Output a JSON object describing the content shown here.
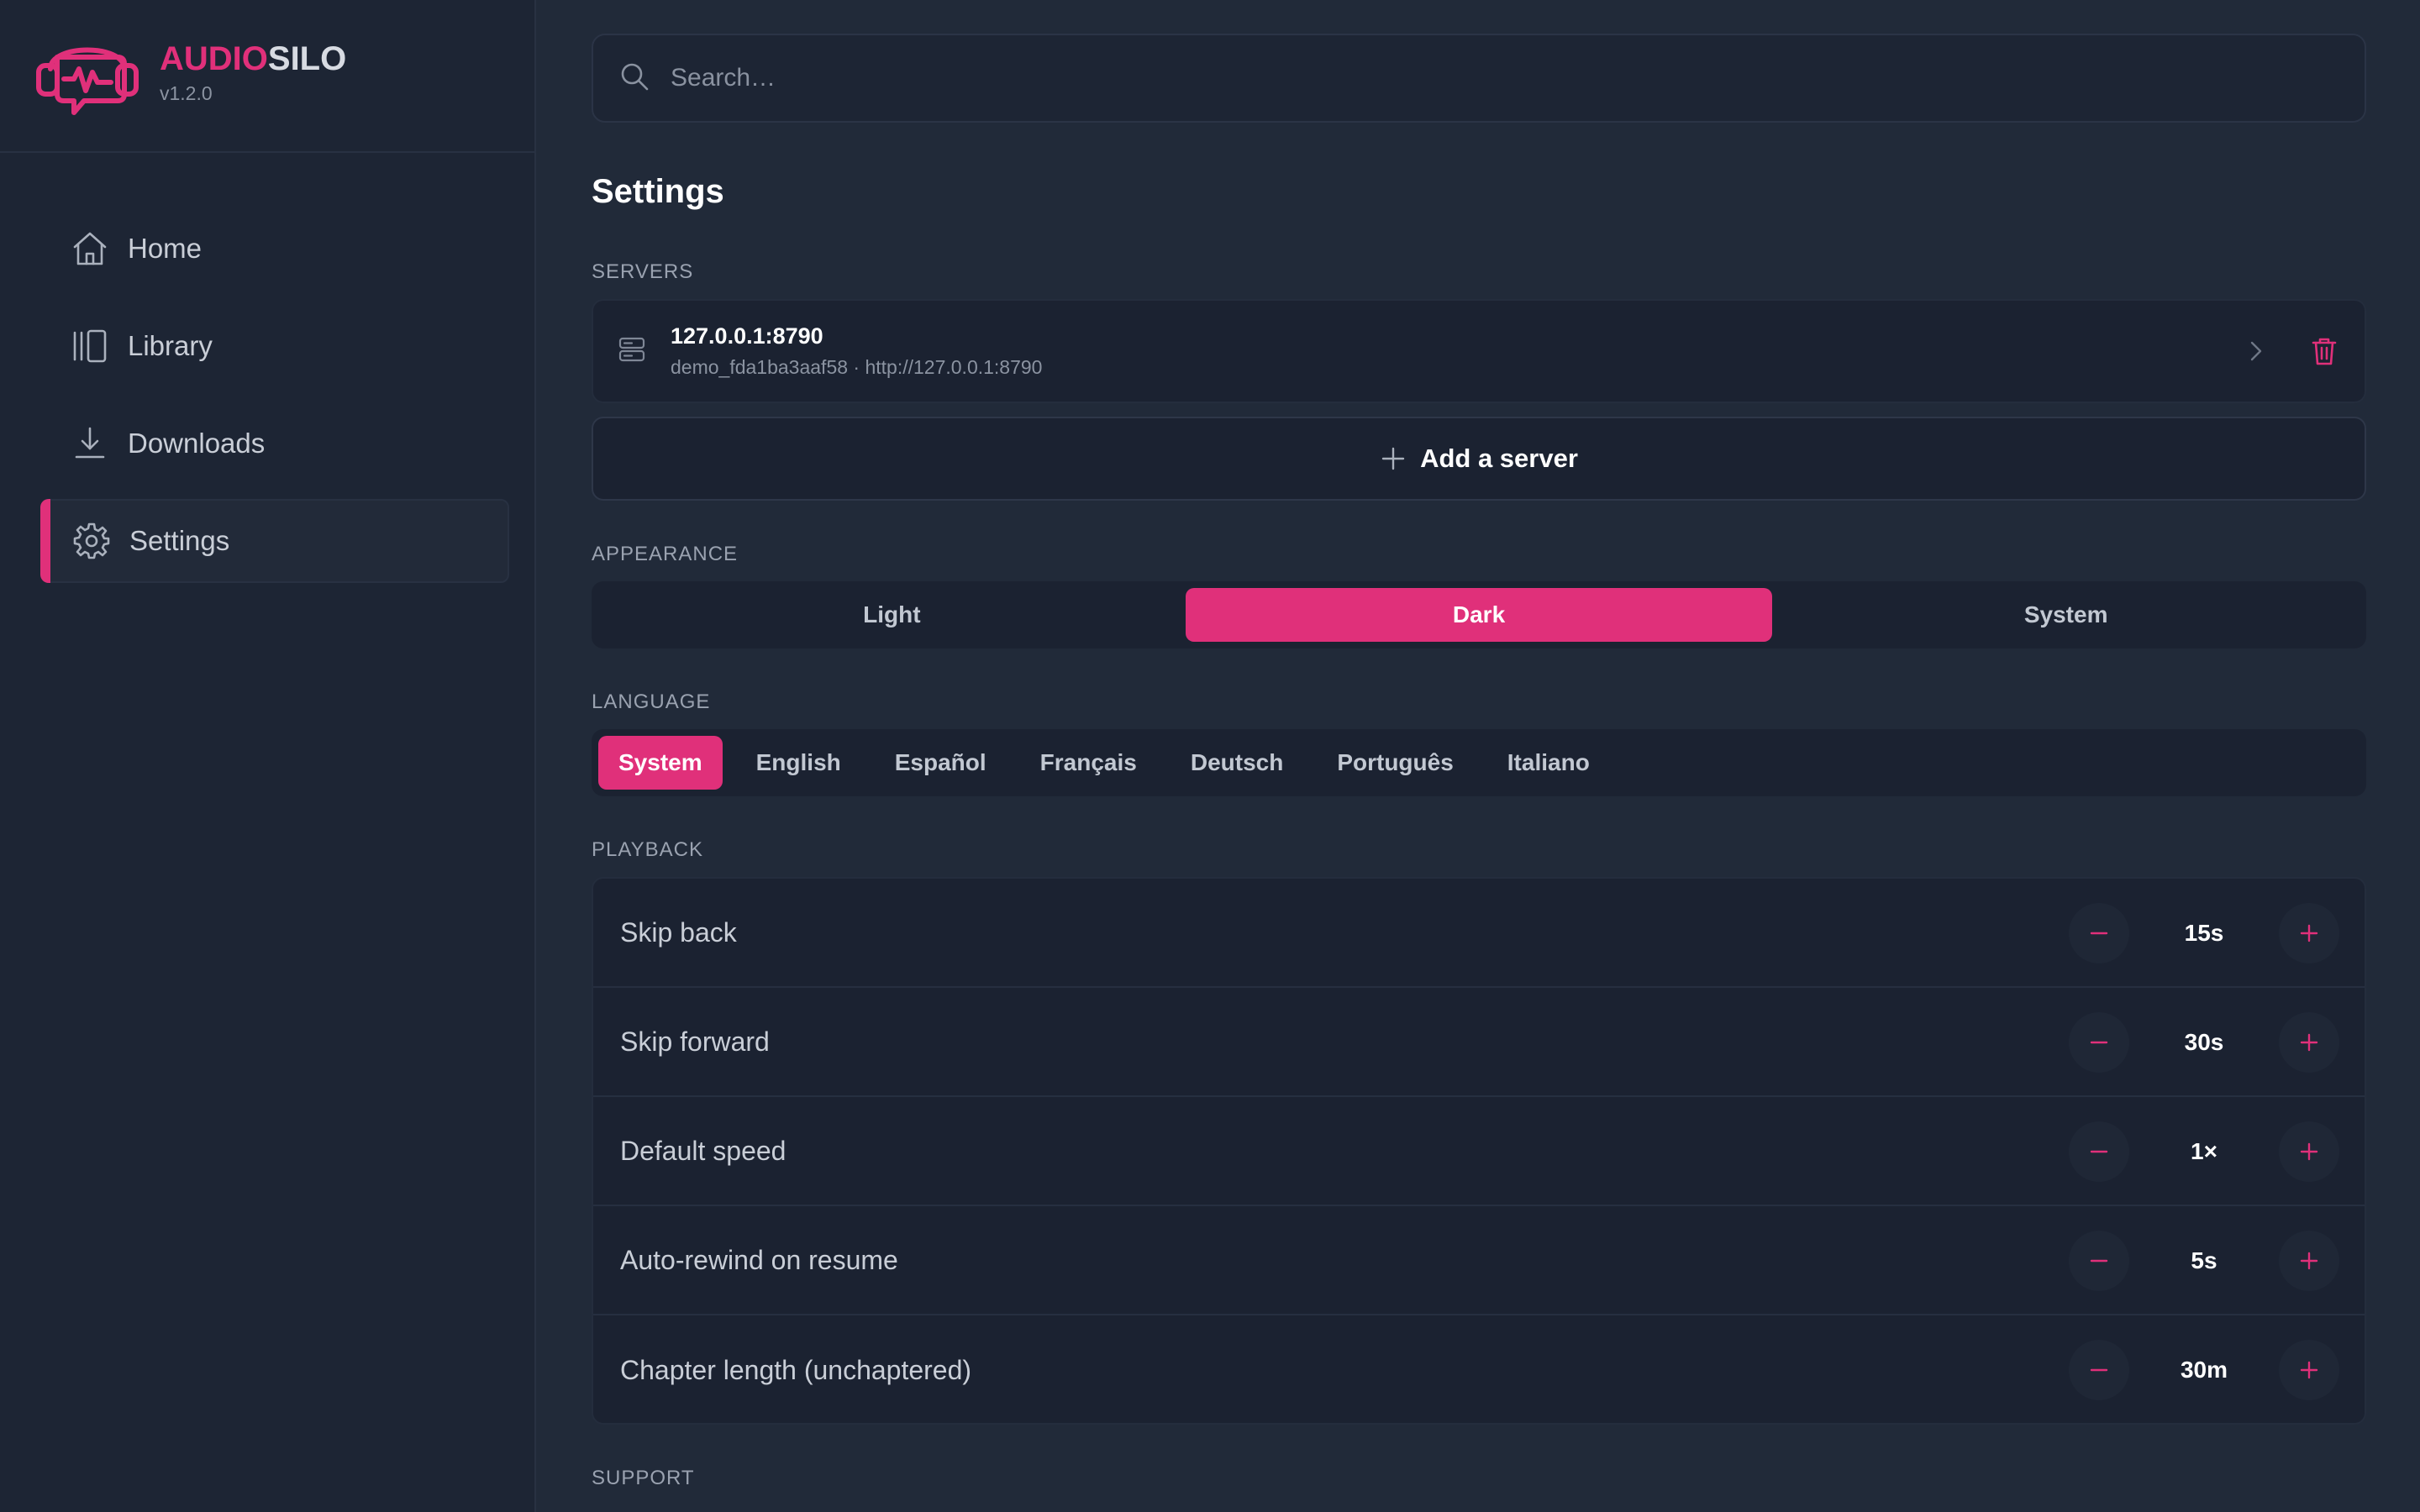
{
  "brand": {
    "name_accent": "AUDIO",
    "name_rest": "SILO",
    "version": "v1.2.0",
    "accent_color": "#e0307a"
  },
  "sidebar": {
    "items": [
      {
        "label": "Home",
        "icon": "home-icon"
      },
      {
        "label": "Library",
        "icon": "library-icon"
      },
      {
        "label": "Downloads",
        "icon": "download-icon"
      },
      {
        "label": "Settings",
        "icon": "gear-icon",
        "active": true
      }
    ]
  },
  "search": {
    "placeholder": "Search…"
  },
  "page": {
    "title": "Settings"
  },
  "sections": {
    "servers": "SERVERS",
    "appearance": "APPEARANCE",
    "language": "LANGUAGE",
    "playback": "PLAYBACK",
    "support": "SUPPORT"
  },
  "server": {
    "name": "127.0.0.1:8790",
    "detail": "demo_fda1ba3aaf58 · http://127.0.0.1:8790"
  },
  "add_server": {
    "label": "Add a server"
  },
  "appearance": {
    "options": [
      "Light",
      "Dark",
      "System"
    ],
    "selected": "Dark"
  },
  "language": {
    "options": [
      "System",
      "English",
      "Español",
      "Français",
      "Deutsch",
      "Português",
      "Italiano"
    ],
    "selected": "System"
  },
  "playback": {
    "rows": [
      {
        "label": "Skip back",
        "value": "15s"
      },
      {
        "label": "Skip forward",
        "value": "30s"
      },
      {
        "label": "Default speed",
        "value": "1×"
      },
      {
        "label": "Auto-rewind on resume",
        "value": "5s"
      },
      {
        "label": "Chapter length (unchaptered)",
        "value": "30m"
      }
    ]
  }
}
